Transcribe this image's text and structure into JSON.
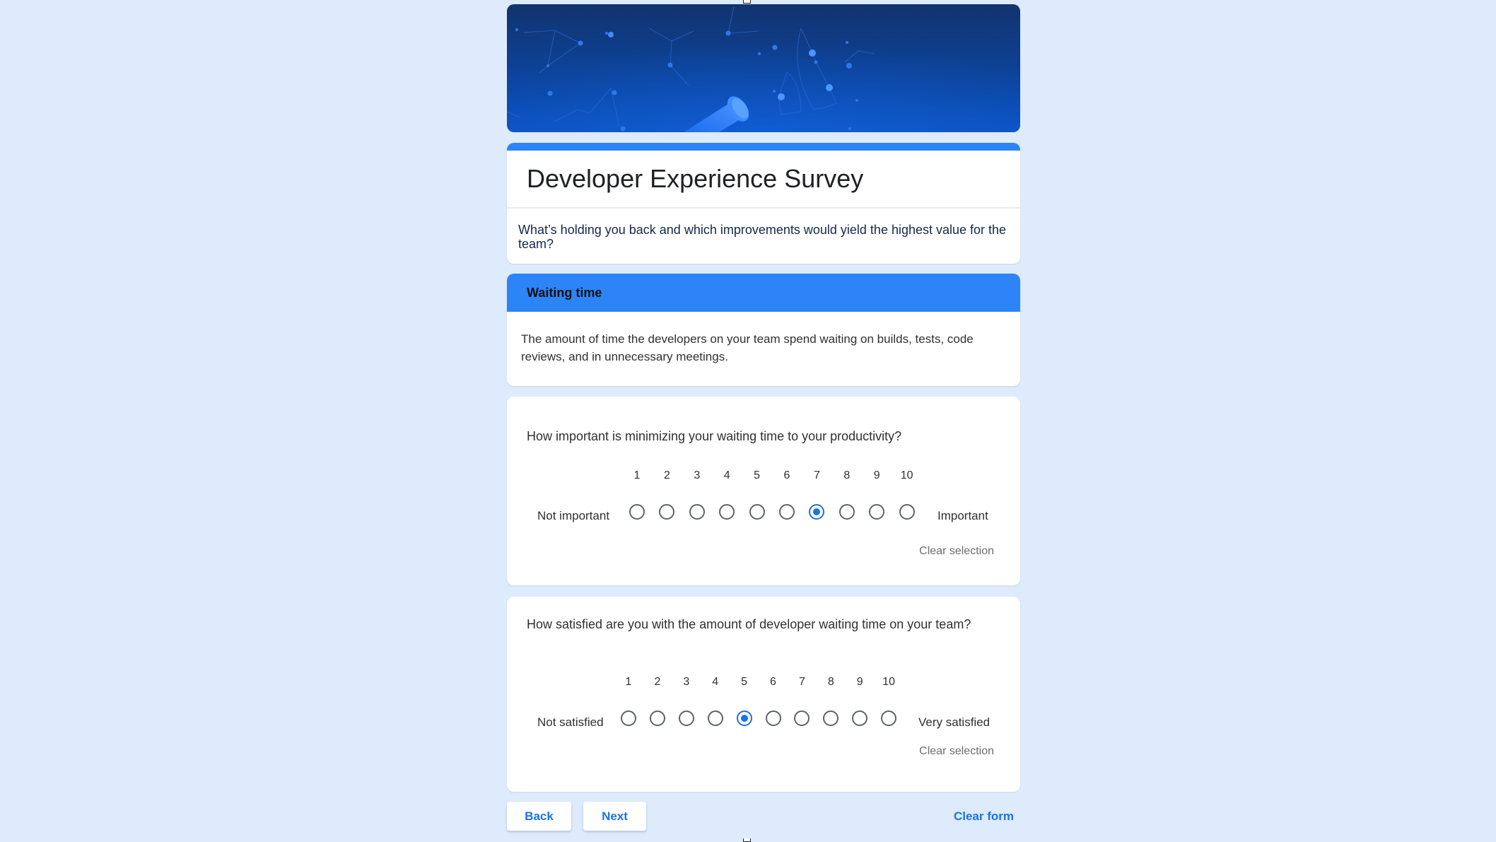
{
  "form": {
    "title": "Developer Experience Survey",
    "description": "What’s holding you back and which improvements would yield the highest value for the team?",
    "theme_color": "#2c84f7",
    "background_color": "#deebfc"
  },
  "section": {
    "title": "Waiting time",
    "description": "The amount of time the developers on your team spend waiting on builds, tests, code reviews, and in unnecessary meetings."
  },
  "questions": [
    {
      "text": "How important is minimizing your waiting time to your productivity?",
      "scale": [
        "1",
        "2",
        "3",
        "4",
        "5",
        "6",
        "7",
        "8",
        "9",
        "10"
      ],
      "min_label": "Not important",
      "max_label": "Important",
      "selected": 7,
      "clear_label": "Clear selection"
    },
    {
      "text": "How satisfied are you with the amount of developer waiting time on your team?",
      "scale": [
        "1",
        "2",
        "3",
        "4",
        "5",
        "6",
        "7",
        "8",
        "9",
        "10"
      ],
      "min_label": "Not satisfied",
      "max_label": "Very satisfied",
      "selected": 5,
      "clear_label": "Clear selection"
    }
  ],
  "navigation": {
    "back_label": "Back",
    "next_label": "Next",
    "clear_form_label": "Clear form"
  },
  "banner": {
    "icon": "telescope-constellation-illustration"
  }
}
